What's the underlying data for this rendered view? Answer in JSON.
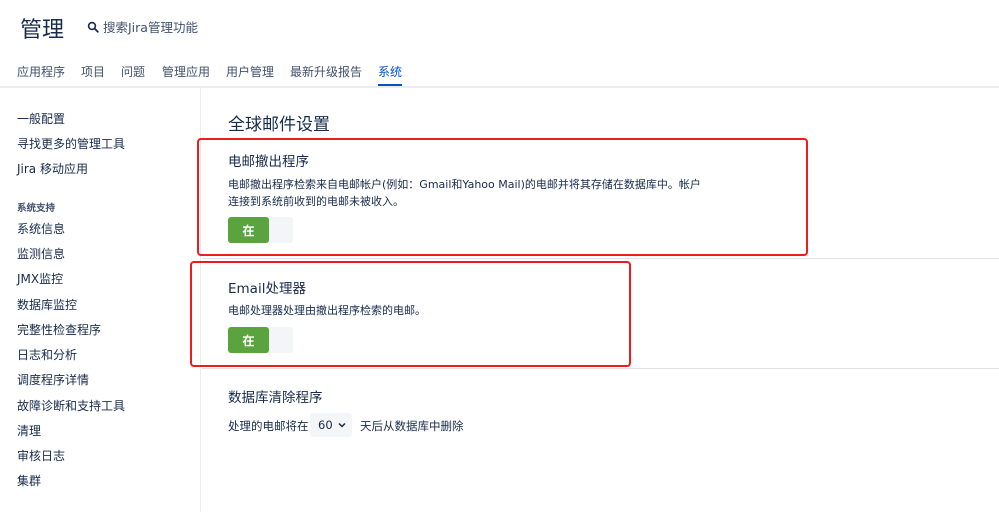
{
  "header": {
    "title": "管理",
    "search_label": "搜索Jira管理功能"
  },
  "tabs": [
    {
      "label": "应用程序"
    },
    {
      "label": "项目"
    },
    {
      "label": "问题"
    },
    {
      "label": "管理应用"
    },
    {
      "label": "用户管理"
    },
    {
      "label": "最新升级报告"
    },
    {
      "label": "系统",
      "active": true
    }
  ],
  "sidebar": {
    "items_top": [
      {
        "label": "一般配置"
      },
      {
        "label": "寻找更多的管理工具"
      },
      {
        "label": "Jira 移动应用"
      }
    ],
    "heading": "系统支持",
    "items_support": [
      {
        "label": "系统信息"
      },
      {
        "label": "监测信息"
      },
      {
        "label": "JMX监控"
      },
      {
        "label": "数据库监控"
      },
      {
        "label": "完整性检查程序"
      },
      {
        "label": "日志和分析"
      },
      {
        "label": "调度程序详情"
      },
      {
        "label": "故障诊断和支持工具"
      },
      {
        "label": "清理"
      },
      {
        "label": "审核日志"
      },
      {
        "label": "集群"
      }
    ]
  },
  "main": {
    "title": "全球邮件设置",
    "mail_puller": {
      "title": "电邮撤出程序",
      "desc_line1": "电邮撤出程序检索来自电邮帐户(例如：Gmail和Yahoo Mail)的电邮并将其存储在数据库中。帐户",
      "desc_line2": "连接到系统前收到的电邮未被收入。",
      "toggle_label": "在"
    },
    "email_handler": {
      "title": "Email处理器",
      "desc": "电邮处理器处理由撤出程序检索的电邮。",
      "toggle_label": "在"
    },
    "db_cleanup": {
      "title": "数据库清除程序",
      "prefix": "处理的电邮将在",
      "days_value": "60",
      "suffix": "天后从数据库中删除"
    }
  },
  "colors": {
    "accent": "#0052cc",
    "toggle_on": "#5aa33f",
    "highlight_box": "#ee1c1c"
  },
  "icons": {
    "search": "search-icon",
    "select_chevron": "chevron-down-icon"
  }
}
